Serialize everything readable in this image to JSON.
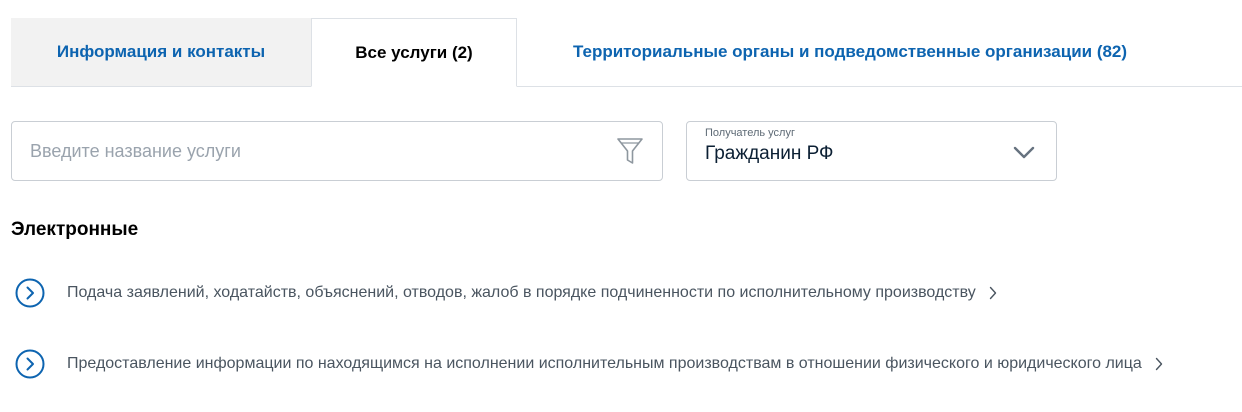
{
  "tabs": [
    {
      "label": "Информация и контакты"
    },
    {
      "label": "Все услуги (2)"
    },
    {
      "label": "Территориальные органы и подведомственные организации (82)"
    }
  ],
  "search": {
    "placeholder": "Введите название услуги",
    "value": ""
  },
  "recipient": {
    "label": "Получатель услуг",
    "value": "Гражданин РФ"
  },
  "section": {
    "title": "Электронные"
  },
  "services": [
    {
      "label": "Подача заявлений, ходатайств, объяснений, отводов, жалоб в порядке подчиненности по исполнительному производству"
    },
    {
      "label": "Предоставление информации по находящимся на исполнении исполнительным производствам в отношении физического и юридического лица"
    }
  ],
  "colors": {
    "link": "#0d64b0",
    "border": "#dde1e6",
    "tab_inactive_bg": "#f2f2f2"
  },
  "icons": {
    "filter": "filter-icon",
    "dropdown": "chevron-down-icon",
    "service": "circle-arrow-right-icon",
    "arrow": "chevron-right-icon"
  }
}
